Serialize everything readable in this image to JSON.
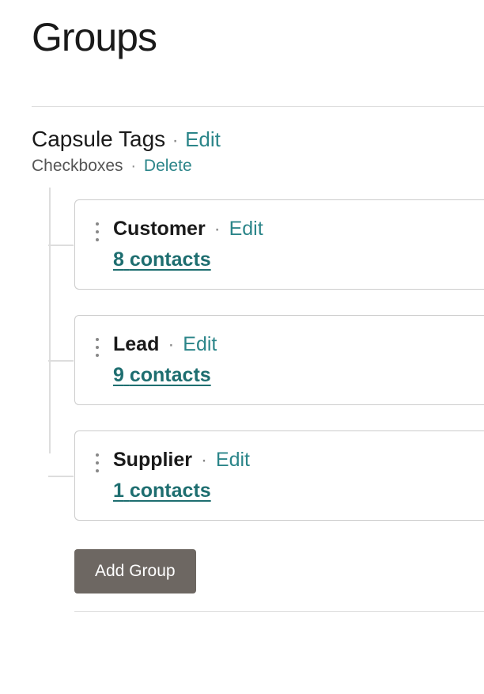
{
  "page": {
    "title": "Groups"
  },
  "section": {
    "title": "Capsule Tags",
    "edit_label": "Edit",
    "type_label": "Checkboxes",
    "delete_label": "Delete"
  },
  "groups": [
    {
      "name": "Customer",
      "edit_label": "Edit",
      "contacts_count": 8,
      "contacts_word": "contacts"
    },
    {
      "name": "Lead",
      "edit_label": "Edit",
      "contacts_count": 9,
      "contacts_word": "contacts"
    },
    {
      "name": "Supplier",
      "edit_label": "Edit",
      "contacts_count": 1,
      "contacts_word": "contacts"
    }
  ],
  "buttons": {
    "add_group": "Add Group"
  },
  "separators": {
    "dot": "·"
  }
}
